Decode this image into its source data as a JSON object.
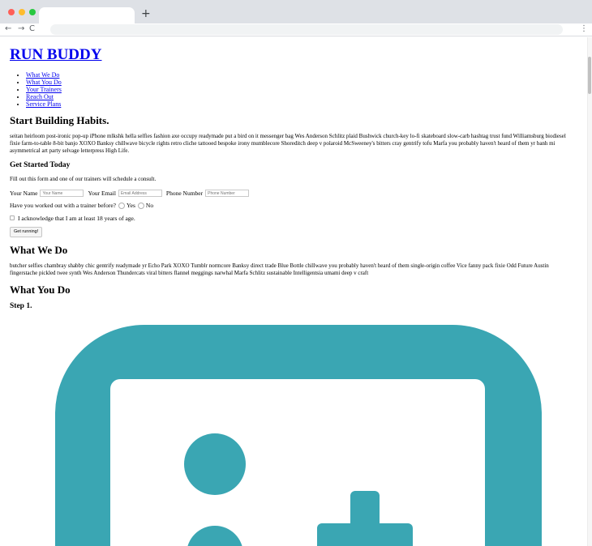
{
  "browser": {
    "new_tab_label": "+",
    "back_glyph": "←",
    "forward_glyph": "→",
    "reload_glyph": "C",
    "menu_glyph": "⋮"
  },
  "site": {
    "title": "RUN BUDDY",
    "nav": [
      "What We Do",
      "What You Do",
      "Your Trainers",
      "Reach Out",
      "Service Plans"
    ]
  },
  "hero": {
    "heading": "Start Building Habits.",
    "text": "seitan heirloom post-ironic pop-up iPhone mlkshk hella selfies fashion axe occupy readymade put a bird on it messenger bag Wes Anderson Schlitz plaid Bushwick church-key lo-fi skateboard slow-carb hashtag trust fund Williamsburg biodiesel fixie farm-to-table 8-bit banjo XOXO Banksy chillwave bicycle rights retro cliche tattooed bespoke irony mumblecore Shoreditch deep v polaroid McSweeney's bitters cray gentrify tofu Marfa you probably haven't heard of them yr banh mi asymmetrical art party selvage letterpress High Life."
  },
  "form": {
    "heading": "Get Started Today",
    "intro": "Fill out this form and one of our trainers will schedule a consult.",
    "name_label": "Your Name",
    "name_placeholder": "Your Name",
    "email_label": "Your Email",
    "email_placeholder": "Email Address",
    "phone_label": "Phone Number",
    "phone_placeholder": "Phone Number",
    "trainer_question": "Have you worked out with a trainer before?",
    "yes_label": "Yes",
    "no_label": "No",
    "age_ack": "I acknowledge that I am at least 18 years of age.",
    "submit_label": "Get running!"
  },
  "what_we_do": {
    "heading": "What We Do",
    "text": "butcher selfies chambray shabby chic gentrify readymade yr Echo Park XOXO Tumblr normcore Banksy direct trade Blue Bottle chillwave you probably haven't heard of them single-origin coffee Vice fanny pack fixie Odd Future Austin fingerstache pickled twee synth Wes Anderson Thundercats viral bitters flannel meggings narwhal Marfa Schlitz sustainable Intelligentsia umami deep v craft"
  },
  "what_you_do": {
    "heading": "What You Do",
    "step1": "Step 1.",
    "icon": "add-user-icon",
    "icon_color": "#3aa6b3"
  }
}
